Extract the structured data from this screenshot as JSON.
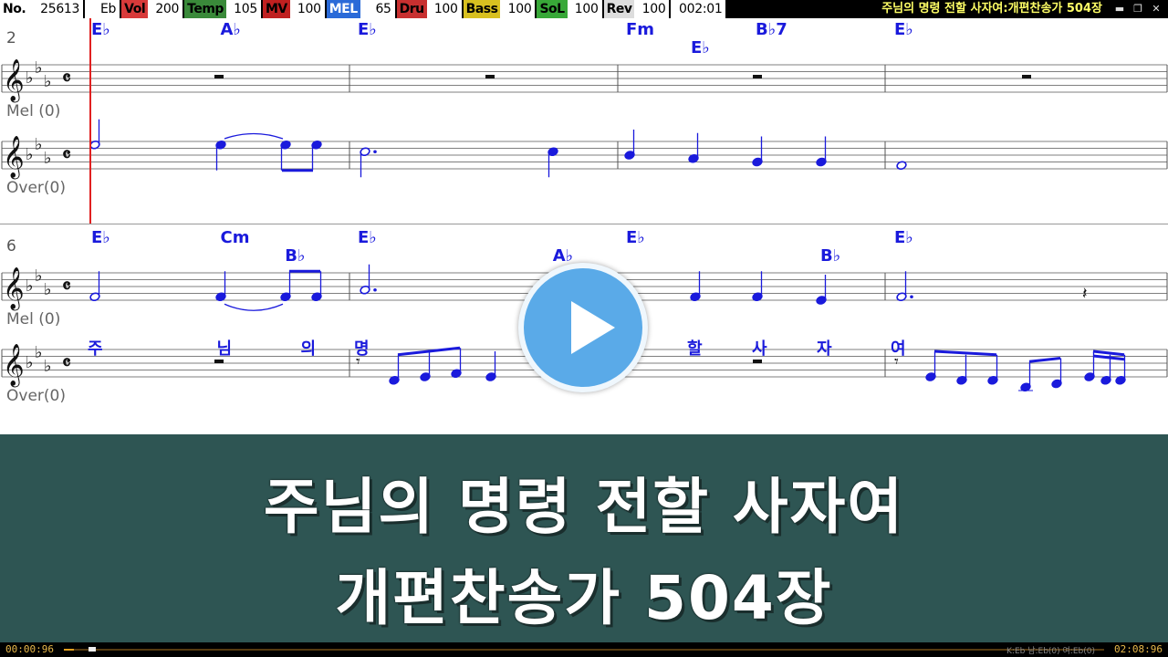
{
  "topbar": {
    "items": [
      {
        "label": "No.",
        "value": "25613",
        "label_bg": "#ffffff",
        "label_fg": "#000000"
      },
      {
        "label": "",
        "value": "Eb",
        "label_bg": "#000000",
        "label_fg": "#000000"
      },
      {
        "label": "Vol",
        "value": "200",
        "label_bg": "#d83a3a",
        "label_fg": "#000000"
      },
      {
        "label": "Temp",
        "value": "105",
        "label_bg": "#3a8a3a",
        "label_fg": "#000000"
      },
      {
        "label": "MV",
        "value": "100",
        "label_bg": "#c02020",
        "label_fg": "#000000"
      },
      {
        "label": "MEL",
        "value": "65",
        "label_bg": "#2a6ad8",
        "label_fg": "#ffffff"
      },
      {
        "label": "Dru",
        "value": "100",
        "label_bg": "#c83030",
        "label_fg": "#000000"
      },
      {
        "label": "Bass",
        "value": "100",
        "label_bg": "#d8c020",
        "label_fg": "#000000"
      },
      {
        "label": "SoL",
        "value": "100",
        "label_bg": "#38a838",
        "label_fg": "#000000"
      },
      {
        "label": "Rev",
        "value": "100",
        "label_bg": "#dddddd",
        "label_fg": "#000000"
      },
      {
        "label": "",
        "value": "002:01",
        "label_bg": "#000000",
        "label_fg": "#000000"
      }
    ],
    "title": "주님의 명령 전할 사자여:개편찬송가 504장",
    "win_buttons": [
      "▬",
      "❐",
      "✕"
    ]
  },
  "score": {
    "systems": [
      {
        "measure_number": "2",
        "chords": [
          {
            "text": "E♭",
            "measure": 0,
            "beat": 0,
            "row": 0
          },
          {
            "text": "A♭",
            "measure": 0,
            "beat": 2,
            "row": 0
          },
          {
            "text": "E♭",
            "measure": 1,
            "beat": 0,
            "row": 0
          },
          {
            "text": "Fm",
            "measure": 2,
            "beat": 0,
            "row": 0
          },
          {
            "text": "E♭",
            "measure": 2,
            "beat": 1,
            "row": 1
          },
          {
            "text": "B♭7",
            "measure": 2,
            "beat": 2,
            "row": 0
          },
          {
            "text": "E♭",
            "measure": 3,
            "beat": 0,
            "row": 0
          }
        ],
        "staff1_label": "Mel (0)",
        "staff2_label": "Over(0)",
        "lyrics": []
      },
      {
        "measure_number": "6",
        "chords": [
          {
            "text": "E♭",
            "measure": 0,
            "beat": 0,
            "row": 0
          },
          {
            "text": "Cm",
            "measure": 0,
            "beat": 2,
            "row": 0
          },
          {
            "text": "B♭",
            "measure": 0,
            "beat": 3,
            "row": 1
          },
          {
            "text": "E♭",
            "measure": 1,
            "beat": 0,
            "row": 0
          },
          {
            "text": "A♭",
            "measure": 1,
            "beat": 3,
            "row": 1
          },
          {
            "text": "E♭",
            "measure": 2,
            "beat": 0,
            "row": 0
          },
          {
            "text": "B♭",
            "measure": 2,
            "beat": 3,
            "row": 1
          },
          {
            "text": "E♭",
            "measure": 3,
            "beat": 0,
            "row": 0
          }
        ],
        "staff1_label": "Mel (0)",
        "staff2_label": "Over(0)",
        "lyrics": [
          {
            "text": "주",
            "measure": 0,
            "beat": 0
          },
          {
            "text": "님",
            "measure": 0,
            "beat": 2
          },
          {
            "text": "의",
            "measure": 0,
            "beat": 3.3
          },
          {
            "text": "명",
            "measure": 1,
            "beat": 0
          },
          {
            "text": "할",
            "measure": 2,
            "beat": 1
          },
          {
            "text": "사",
            "measure": 2,
            "beat": 2
          },
          {
            "text": "자",
            "measure": 2,
            "beat": 3
          },
          {
            "text": "여",
            "measure": 3,
            "beat": 0
          }
        ]
      }
    ],
    "colors": {
      "notes": "#1a1adc",
      "chords": "#1a1adc",
      "lyrics": "#1a1adc",
      "staff": "#555555",
      "cursor": "#e02020",
      "labels": "#666666"
    }
  },
  "caption": {
    "line1": "주님의 명령 전할 사자여",
    "line2": "개편찬송가 504장",
    "bg": "#2e5553"
  },
  "progress": {
    "current_time": "00:00:96",
    "total_time": "02:08:96",
    "fraction": 0.01,
    "key_info": "K:Eb 남:Eb(0) 여:Eb(0)"
  },
  "overlay": {
    "icon": "play-icon"
  }
}
